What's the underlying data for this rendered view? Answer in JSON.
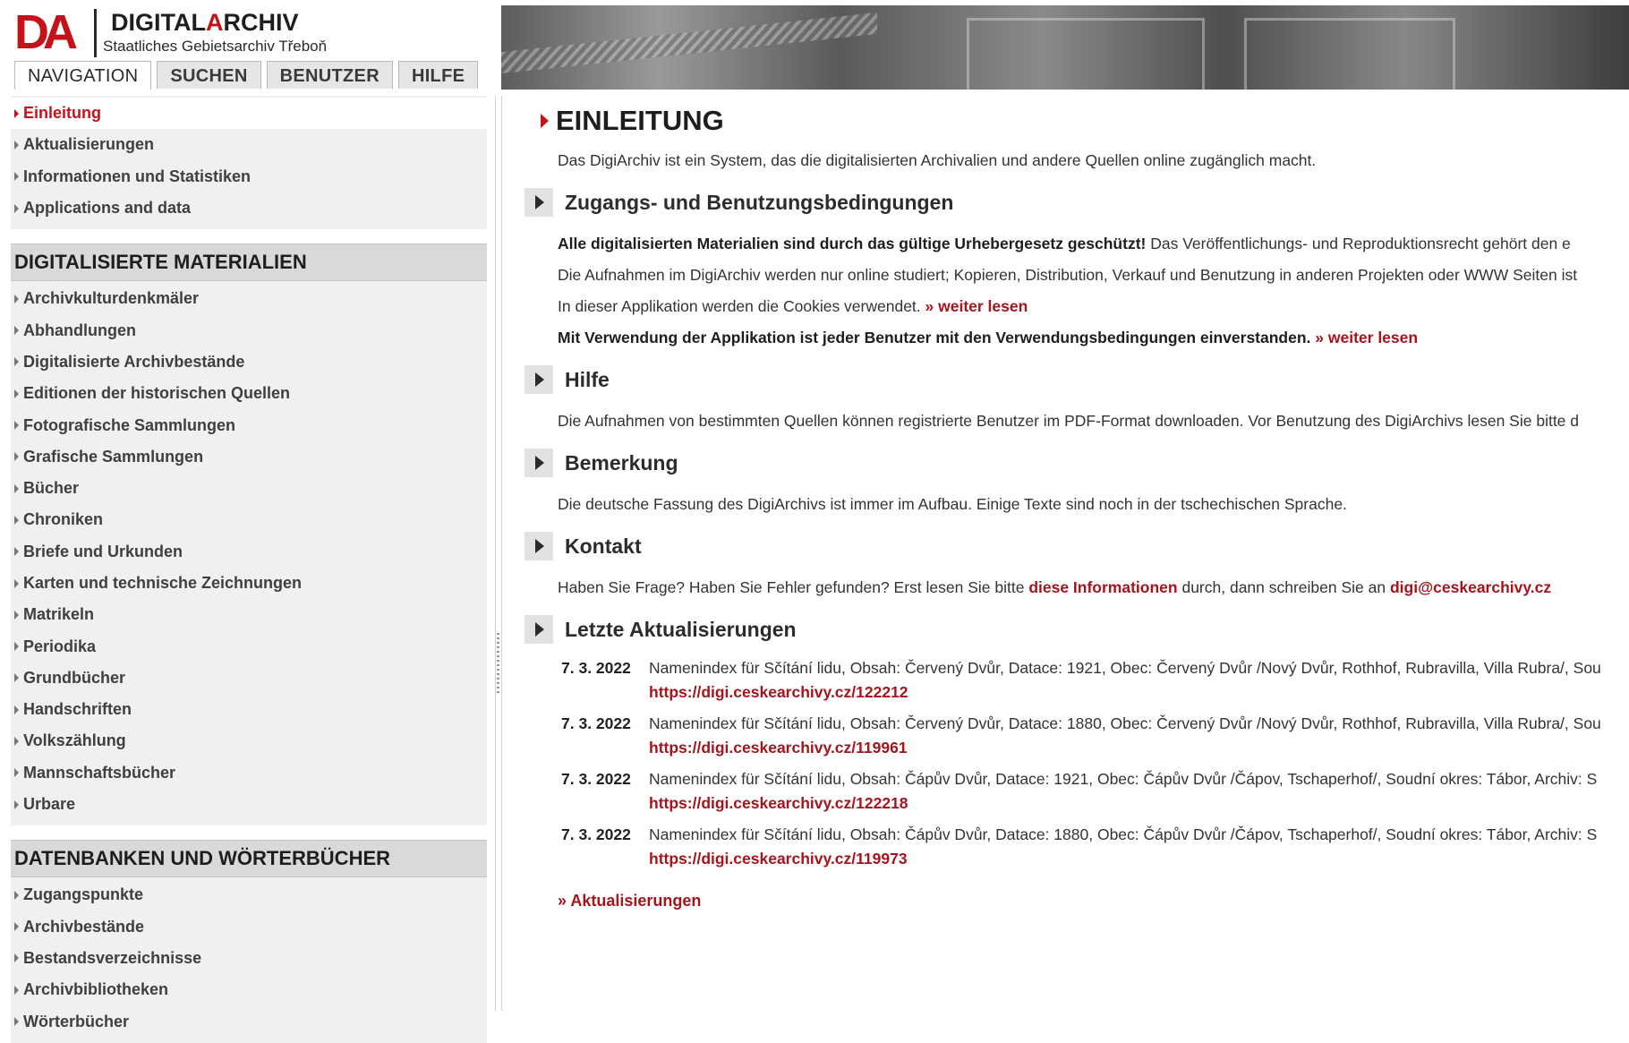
{
  "header": {
    "logo_mark": "DA",
    "logo_title_a": "DIGITAL",
    "logo_title_b": "A",
    "logo_title_c": "RCHIV",
    "logo_subtitle": "Staatliches Gebietsarchiv Třeboň",
    "tabs": [
      {
        "label": "NAVIGATION",
        "active": true
      },
      {
        "label": "SUCHEN",
        "active": false
      },
      {
        "label": "BENUTZER",
        "active": false
      },
      {
        "label": "HILFE",
        "active": false
      }
    ]
  },
  "sidebar": {
    "top_items": [
      {
        "label": "Einleitung",
        "active": true
      },
      {
        "label": "Aktualisierungen"
      },
      {
        "label": "Informationen und Statistiken"
      },
      {
        "label": "Applications and data"
      }
    ],
    "section1": {
      "title": "DIGITALISIERTE MATERIALIEN",
      "items": [
        "Archivkulturdenkmäler",
        "Abhandlungen",
        "Digitalisierte Archivbestände",
        "Editionen der historischen Quellen",
        "Fotografische Sammlungen",
        "Grafische Sammlungen",
        "Bücher",
        "Chroniken",
        "Briefe und Urkunden",
        "Karten und technische Zeichnungen",
        "Matrikeln",
        "Periodika",
        "Grundbücher",
        "Handschriften",
        "Volkszählung",
        "Mannschaftsbücher",
        "Urbare"
      ]
    },
    "section2": {
      "title": "DATENBANKEN UND WÖRTERBÜCHER",
      "items": [
        "Zugangspunkte",
        "Archivbestände",
        "Bestandsverzeichnisse",
        "Archivbibliotheken",
        "Wörterbücher"
      ]
    }
  },
  "main": {
    "title": "EINLEITUNG",
    "intro": "Das DigiArchiv ist ein System, das die digitalisierten Archivalien und andere Quellen online zugänglich macht.",
    "access": {
      "heading": "Zugangs- und Benutzungsbedingungen",
      "p1_bold": "Alle digitalisierten Materialien sind durch das gültige Urhebergesetz geschützt!",
      "p1_rest": " Das Veröffentlichungs- und Reproduktionsrecht gehört den e",
      "p2": "Die Aufnahmen im DigiArchiv werden nur online studiert; Kopieren, Distribution, Verkauf und Benutzung in anderen Projekten oder WWW Seiten ist",
      "p3": "In dieser Applikation werden die Cookies verwendet. ",
      "p3_link": "» weiter lesen",
      "p4_bold": "Mit Verwendung der Applikation ist jeder Benutzer mit den Verwendungsbedingungen einverstanden. ",
      "p4_link": "» weiter lesen"
    },
    "help": {
      "heading": "Hilfe",
      "text": "Die Aufnahmen von bestimmten Quellen können registrierte Benutzer im PDF-Format downloaden. Vor Benutzung des DigiArchivs lesen Sie bitte d"
    },
    "note": {
      "heading": "Bemerkung",
      "text": "Die deutsche Fassung des DigiArchivs ist immer im Aufbau. Einige Texte sind noch in der tschechischen Sprache."
    },
    "contact": {
      "heading": "Kontakt",
      "t1": "Haben Sie Frage? Haben Sie Fehler gefunden? Erst lesen Sie bitte ",
      "link1": "diese Informationen",
      "t2": " durch, dann schreiben Sie an ",
      "email": "digi@ceskearchivy.cz"
    },
    "updates": {
      "heading": "Letzte Aktualisierungen",
      "items": [
        {
          "date": "7. 3. 2022",
          "text": "Namenindex für Sčítání lidu, Obsah: Červený Dvůr, Datace: 1921, Obec: Červený Dvůr /Nový Dvůr, Rothhof, Rubravilla, Villa Rubra/, Sou",
          "url": "https://digi.ceskearchivy.cz/122212"
        },
        {
          "date": "7. 3. 2022",
          "text": "Namenindex für Sčítání lidu, Obsah: Červený Dvůr, Datace: 1880, Obec: Červený Dvůr /Nový Dvůr, Rothhof, Rubravilla, Villa Rubra/, Sou",
          "url": "https://digi.ceskearchivy.cz/119961"
        },
        {
          "date": "7. 3. 2022",
          "text": "Namenindex für Sčítání lidu, Obsah: Čápův Dvůr, Datace: 1921, Obec: Čápův Dvůr /Čápov, Tschaperhof/, Soudní okres: Tábor, Archiv: S",
          "url": "https://digi.ceskearchivy.cz/122218"
        },
        {
          "date": "7. 3. 2022",
          "text": "Namenindex für Sčítání lidu, Obsah: Čápův Dvůr, Datace: 1880, Obec: Čápův Dvůr /Čápov, Tschaperhof/, Soudní okres: Tábor, Archiv: S",
          "url": "https://digi.ceskearchivy.cz/119973"
        }
      ],
      "more_link": "» Aktualisierungen"
    }
  },
  "colors": {
    "accent": "#c4121a",
    "link": "#a6141e",
    "nav_bg": "#f0f0f0",
    "section_bg": "#d9d9d9"
  }
}
